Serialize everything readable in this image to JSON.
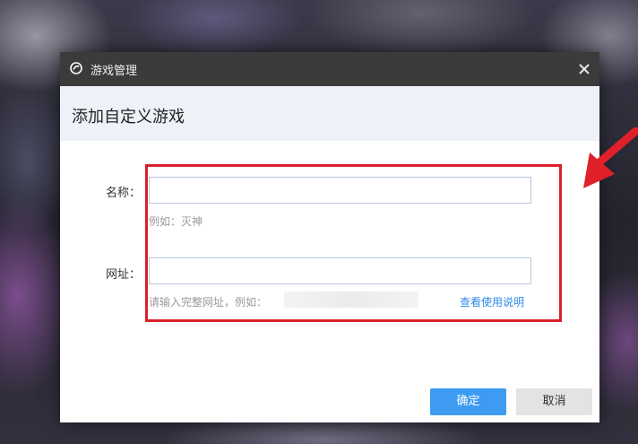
{
  "window": {
    "title": "游戏管理",
    "app_icon": "game-logo-icon",
    "close_icon": "close-icon"
  },
  "header": {
    "title": "添加自定义游戏"
  },
  "form": {
    "name": {
      "label": "名称：",
      "value": "",
      "hint": "例如：灭神"
    },
    "url": {
      "label": "网址：",
      "value": "",
      "hint": "请输入完整网址，例如：",
      "help_link": "查看使用说明"
    }
  },
  "buttons": {
    "ok": "确定",
    "cancel": "取消"
  },
  "annotation": {
    "highlight_color": "#d9202a",
    "arrow_color": "#e0202a"
  },
  "colors": {
    "titlebar": "#3b3b3b",
    "header_bg": "#eef1f8",
    "primary": "#3d9cf2",
    "link": "#2f8be6"
  }
}
